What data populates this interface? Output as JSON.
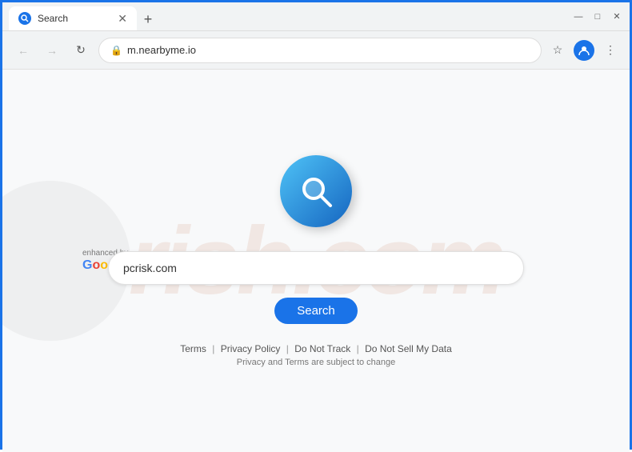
{
  "browser": {
    "tab": {
      "title": "Search",
      "favicon": "🔍"
    },
    "new_tab_icon": "+",
    "window_controls": {
      "minimize": "—",
      "maximize": "□",
      "close": "✕"
    },
    "address_bar": {
      "url": "m.nearbyme.io",
      "lock_icon": "🔒"
    }
  },
  "page": {
    "watermark_text": "rish.com",
    "enhanced_by": "enhanced by",
    "google_text": "Google",
    "search_input_value": "pcrisk.com",
    "search_button_label": "Search",
    "footer": {
      "terms": "Terms",
      "privacy_policy": "Privacy Policy",
      "do_not_track": "Do Not Track",
      "do_not_sell": "Do Not Sell My Data",
      "subtext": "Privacy and Terms are subject to change"
    }
  }
}
